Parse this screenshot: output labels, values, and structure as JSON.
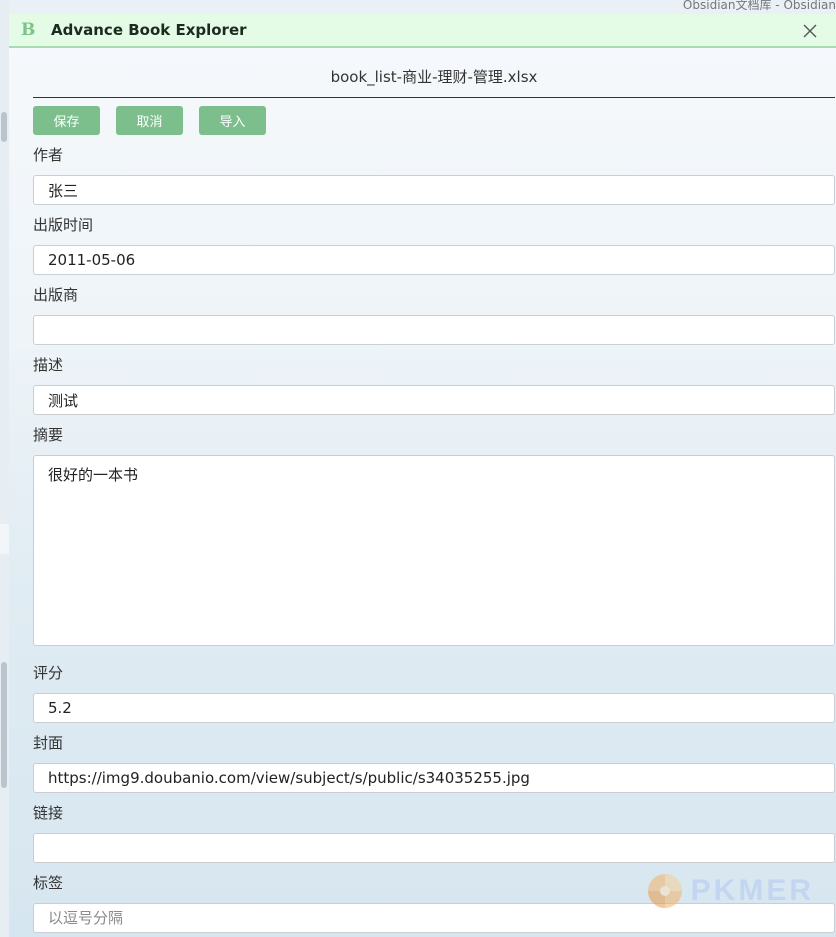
{
  "background_window_title": "Obsidian文档库 - Obsidian",
  "modal": {
    "title": "Advance Book Explorer",
    "logo_letter": "B",
    "close_icon": "close-icon"
  },
  "file_title": "book_list-商业-理财-管理.xlsx",
  "toolbar": {
    "save_label": "保存",
    "cancel_label": "取消",
    "import_label": "导入"
  },
  "fields": {
    "author": {
      "label": "作者",
      "value": "张三"
    },
    "publish_date": {
      "label": "出版时间",
      "value": "2011-05-06"
    },
    "publisher": {
      "label": "出版商",
      "value": ""
    },
    "description": {
      "label": "描述",
      "value": "测试"
    },
    "summary": {
      "label": "摘要",
      "value": "很好的一本书"
    },
    "rating": {
      "label": "评分",
      "value": "5.2"
    },
    "cover": {
      "label": "封面",
      "value": "https://img9.doubanio.com/view/subject/s/public/s34035255.jpg"
    },
    "link": {
      "label": "链接",
      "value": ""
    },
    "tags": {
      "label": "标签",
      "value": "",
      "placeholder": "以逗号分隔"
    }
  },
  "watermark": {
    "text": "PKMER"
  },
  "colors": {
    "titlebar_bg": "#e4fbe6",
    "titlebar_border": "#a8dcae",
    "button_bg": "#7dbf8c",
    "logo_green": "#7cc486"
  }
}
